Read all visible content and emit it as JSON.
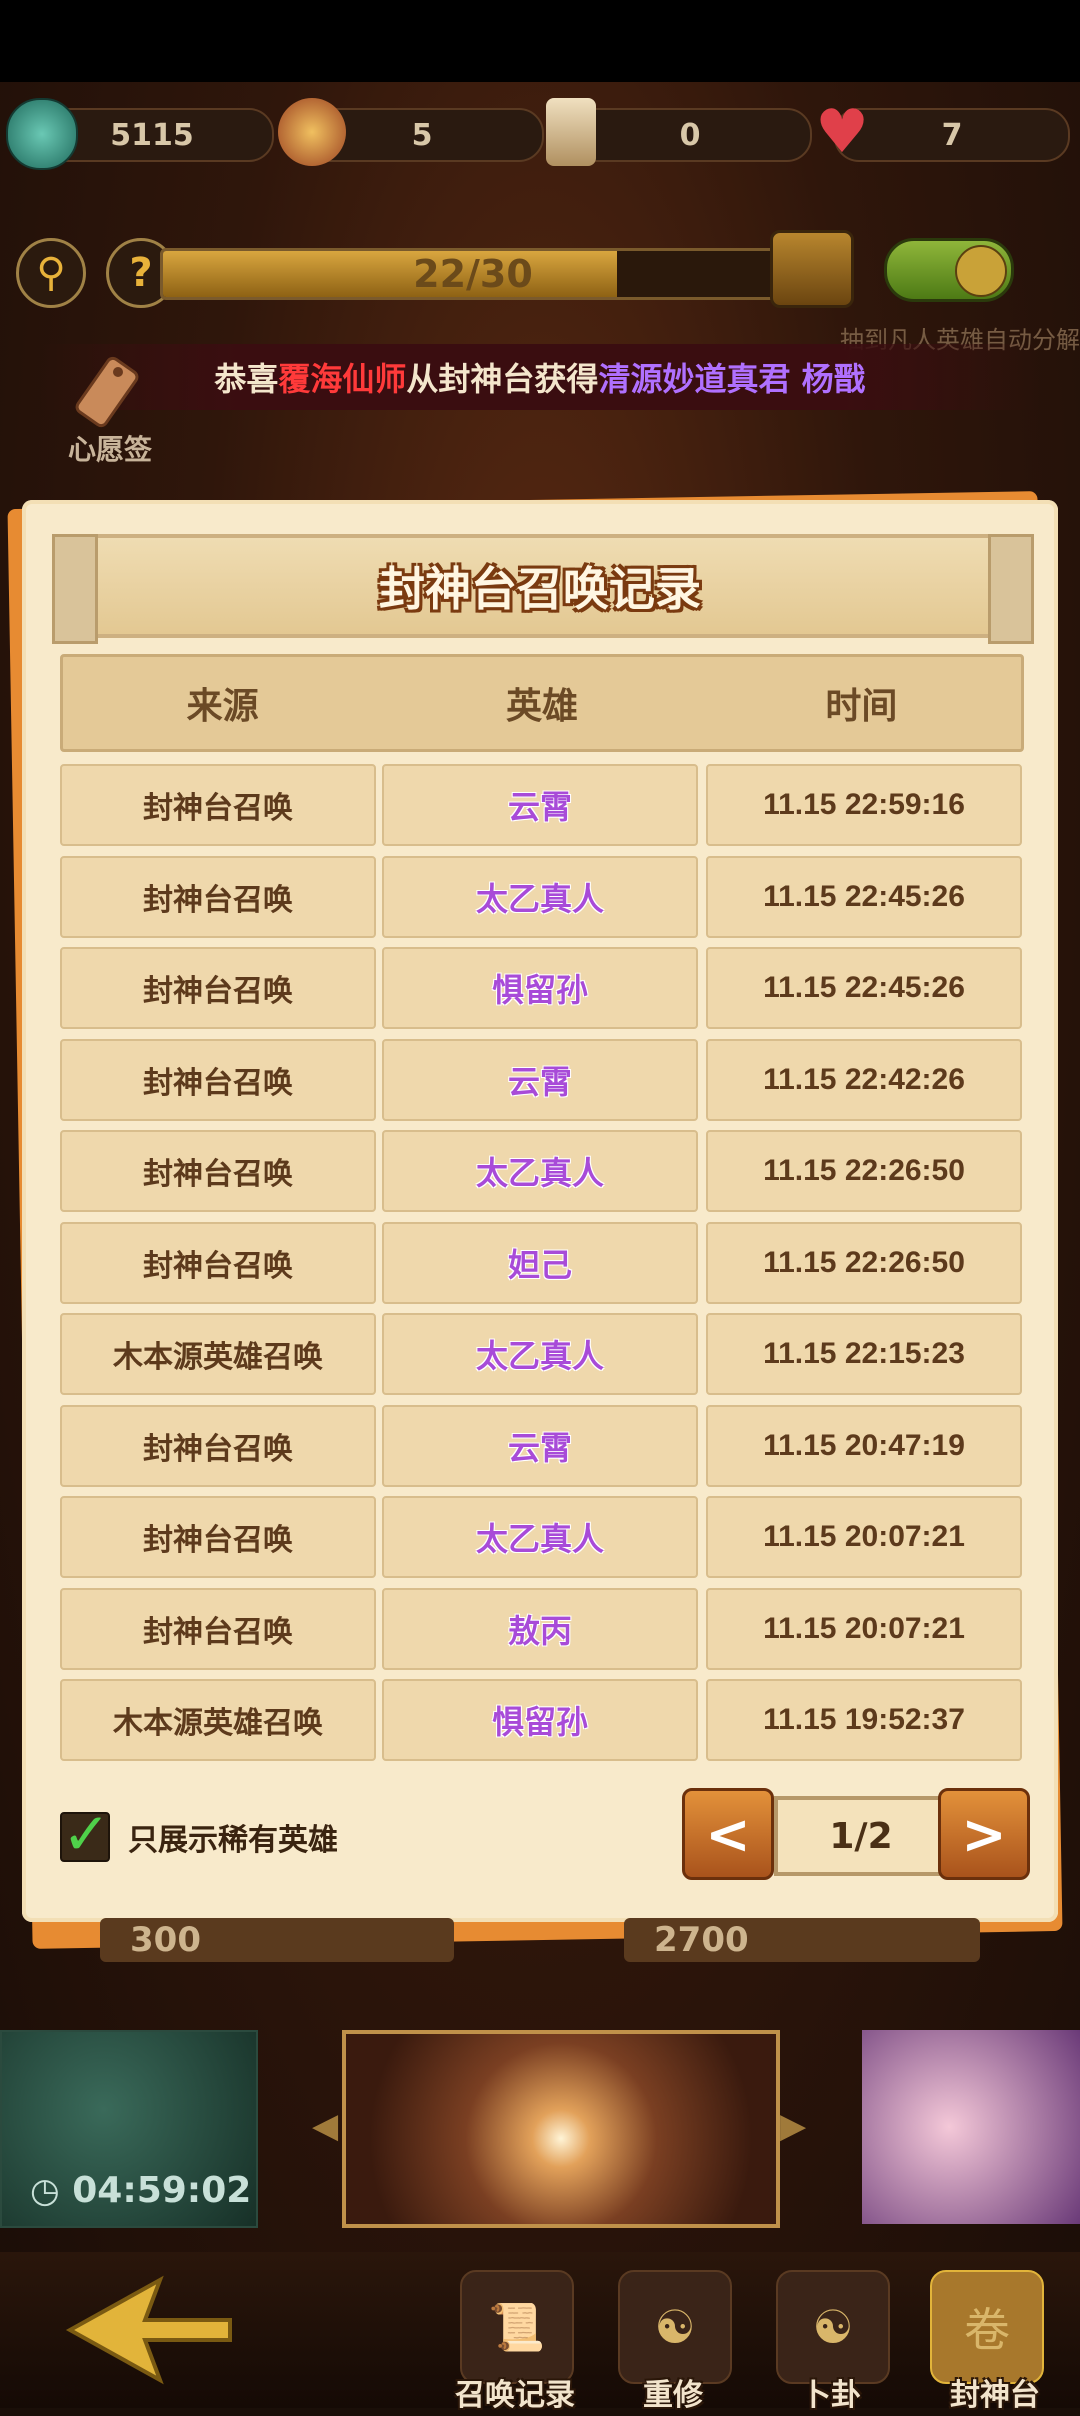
{
  "resources": [
    {
      "icon": "coin-icon",
      "value": "5115"
    },
    {
      "icon": "scroll-bag-icon",
      "value": "5"
    },
    {
      "icon": "talisman-icon",
      "value": "0"
    },
    {
      "icon": "heart-icon",
      "value": "7"
    }
  ],
  "progress": {
    "text": "22/30",
    "fraction": 0.733
  },
  "auto_decompose_label": "抽到凡人英雄自动分解",
  "announcement": {
    "prefix": "恭喜 ",
    "player": "覆海仙师",
    "middle": " 从封神台获得 ",
    "hero": "清源妙道真君 杨戬",
    "colors": {
      "prefix": "#f4e6cc",
      "player": "#ff3a3a",
      "hero": "#b070ff"
    }
  },
  "wish_label": "心愿签",
  "dialog": {
    "title": "封神台召唤记录",
    "columns": [
      "来源",
      "英雄",
      "时间"
    ],
    "rows": [
      {
        "source": "封神台召唤",
        "hero": "云霄",
        "time": "11.15 22:59:16"
      },
      {
        "source": "封神台召唤",
        "hero": "太乙真人",
        "time": "11.15 22:45:26"
      },
      {
        "source": "封神台召唤",
        "hero": "惧留孙",
        "time": "11.15 22:45:26"
      },
      {
        "source": "封神台召唤",
        "hero": "云霄",
        "time": "11.15 22:42:26"
      },
      {
        "source": "封神台召唤",
        "hero": "太乙真人",
        "time": "11.15 22:26:50"
      },
      {
        "source": "封神台召唤",
        "hero": "妲己",
        "time": "11.15 22:26:50"
      },
      {
        "source": "木本源英雄召唤",
        "hero": "太乙真人",
        "time": "11.15 22:15:23"
      },
      {
        "source": "封神台召唤",
        "hero": "云霄",
        "time": "11.15 20:47:19"
      },
      {
        "source": "封神台召唤",
        "hero": "太乙真人",
        "time": "11.15 20:07:21"
      },
      {
        "source": "封神台召唤",
        "hero": "敖丙",
        "time": "11.15 20:07:21"
      },
      {
        "source": "木本源英雄召唤",
        "hero": "惧留孙",
        "time": "11.15 19:52:37"
      }
    ],
    "rare_only_label": "只展示稀有英雄",
    "rare_only_checked": true,
    "prev_label": "<",
    "next_label": ">",
    "page": "1/2"
  },
  "costs": [
    "300",
    "2700"
  ],
  "timer": "04:59:02",
  "nav": [
    {
      "icon": "record-scroll-icon",
      "label": "召唤记录"
    },
    {
      "icon": "monk-icon",
      "label": "重修"
    },
    {
      "icon": "yin-yang-icon",
      "label": "卜卦"
    },
    {
      "icon": "altar-icon",
      "label": "封神台"
    }
  ]
}
